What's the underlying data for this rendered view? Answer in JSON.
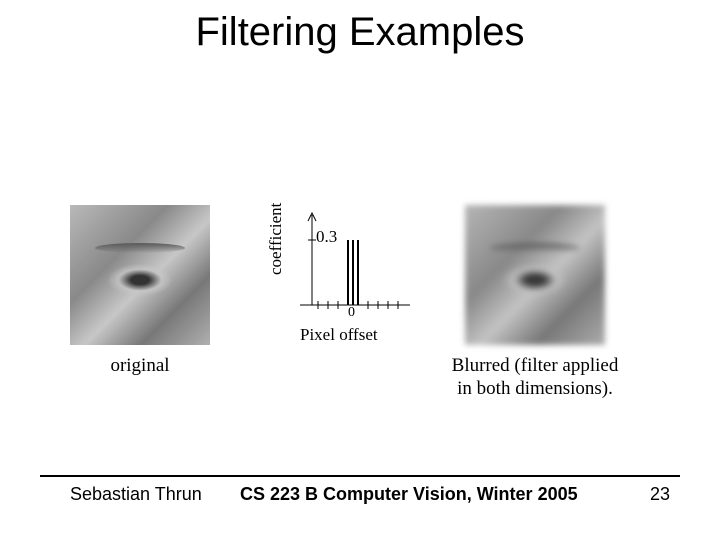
{
  "title": "Filtering Examples",
  "panels": {
    "original": {
      "caption": "original"
    },
    "kernel": {
      "ylabel": "coefficient",
      "yvalue": "0.3",
      "xlabel": "Pixel offset",
      "zero": "0"
    },
    "blurred": {
      "caption": "Blurred (filter applied in both dimensions)."
    }
  },
  "footer": {
    "author": "Sebastian Thrun",
    "course": "CS 223 B Computer Vision, Winter 2005",
    "page": "23"
  }
}
